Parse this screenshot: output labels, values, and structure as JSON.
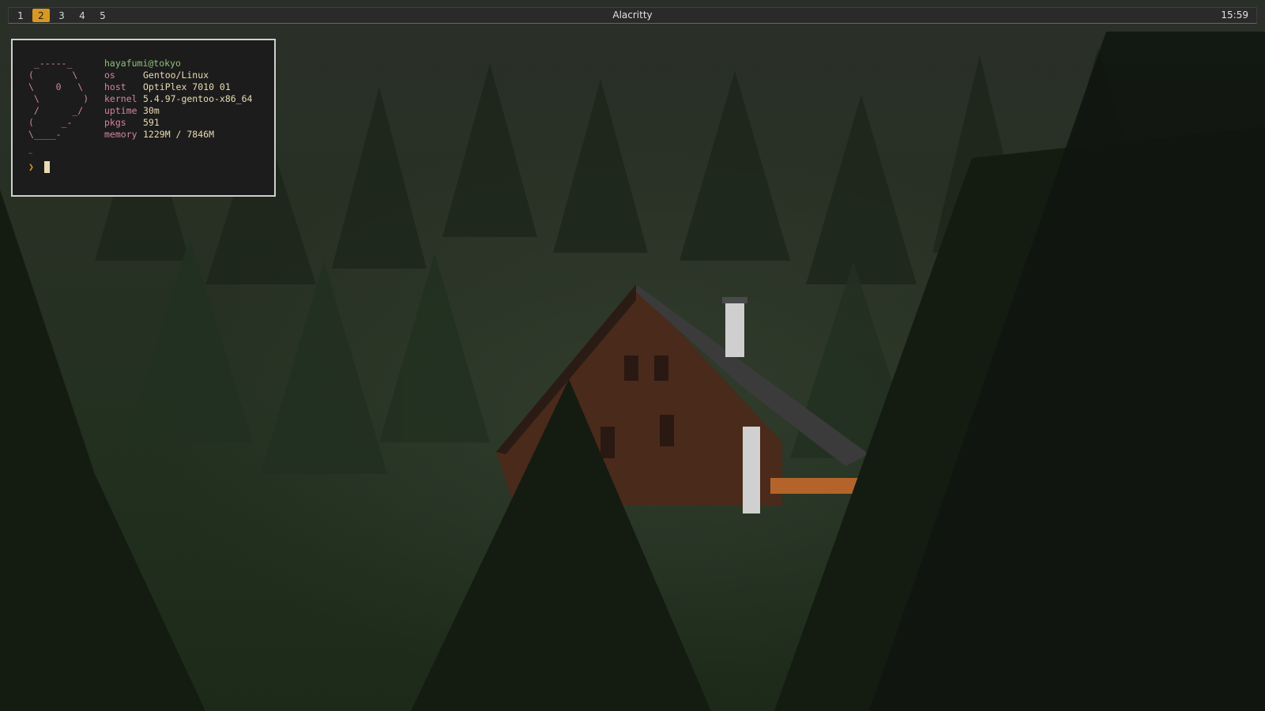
{
  "topbar": {
    "workspaces": [
      "1",
      "2",
      "3",
      "4",
      "5"
    ],
    "active_workspace": "2",
    "window_title": "Alacritty",
    "clock": "15:59"
  },
  "terminal": {
    "ascii_logo": " _-----_\n(       \\\n\\    0   \\\n \\        )\n /      _/\n(     _-\n\\____-",
    "user_host": "hayafumi@tokyo",
    "fields": [
      {
        "key": "os",
        "value": "Gentoo/Linux"
      },
      {
        "key": "host",
        "value": "OptiPlex 7010 01"
      },
      {
        "key": "kernel",
        "value": "5.4.97-gentoo-x86_64"
      },
      {
        "key": "uptime",
        "value": "30m"
      },
      {
        "key": "pkgs",
        "value": "591"
      },
      {
        "key": "memory",
        "value": "1229M / 7846M"
      }
    ],
    "prompt_dir": "~",
    "prompt_symbol": "❯"
  },
  "colors": {
    "accent": "#d79921",
    "ascii": "#d3869b",
    "user": "#8ec07c",
    "text": "#ebdbb2",
    "terminal_bg": "#1c1c1c",
    "bar_bg": "#2a2a2a"
  },
  "icons": [
    "cursor-block-icon",
    "prompt-chevron-icon"
  ]
}
